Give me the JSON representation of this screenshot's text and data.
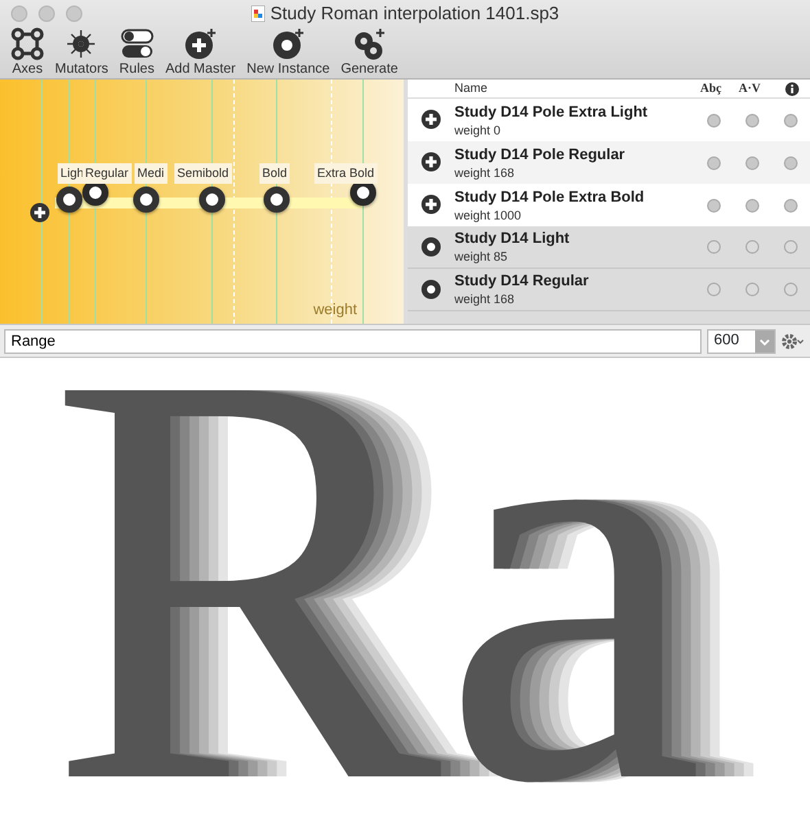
{
  "window": {
    "title": "Study Roman interpolation 1401.sp3"
  },
  "toolbar": [
    {
      "label": "Axes",
      "kind": "axes"
    },
    {
      "label": "Mutators",
      "kind": "mutators"
    },
    {
      "label": "Rules",
      "kind": "rules"
    },
    {
      "label": "Add Master",
      "kind": "add-master"
    },
    {
      "label": "New Instance",
      "kind": "new-instance"
    },
    {
      "label": "Generate",
      "kind": "generate"
    }
  ],
  "axis": {
    "label": "weight",
    "markers": [
      {
        "label": "Ligh",
        "kind": "instance"
      },
      {
        "label": "Regular",
        "kind": "master"
      },
      {
        "label": "Medi",
        "kind": "instance"
      },
      {
        "label": "Semibold",
        "kind": "instance"
      },
      {
        "label": "Bold",
        "kind": "instance"
      },
      {
        "label": "Extra Bold",
        "kind": "master"
      }
    ]
  },
  "table": {
    "columns": [
      "Name",
      "Abç",
      "A·V"
    ],
    "rows": [
      {
        "name": "Study D14 Pole Extra Light",
        "location": "weight 0",
        "kind": "master",
        "selected": false
      },
      {
        "name": "Study D14 Pole Regular",
        "location": "weight 168",
        "kind": "master",
        "selected": false
      },
      {
        "name": "Study D14 Pole Extra Bold",
        "location": "weight 1000",
        "kind": "master",
        "selected": false
      },
      {
        "name": "Study D14 Light",
        "location": "weight 85",
        "kind": "instance",
        "selected": true
      },
      {
        "name": "Study D14 Regular",
        "location": "weight 168",
        "kind": "instance",
        "selected": true
      }
    ]
  },
  "preview_bar": {
    "text": "Range",
    "size": "600"
  },
  "preview": {
    "text": "Ra",
    "color": "#555555"
  }
}
